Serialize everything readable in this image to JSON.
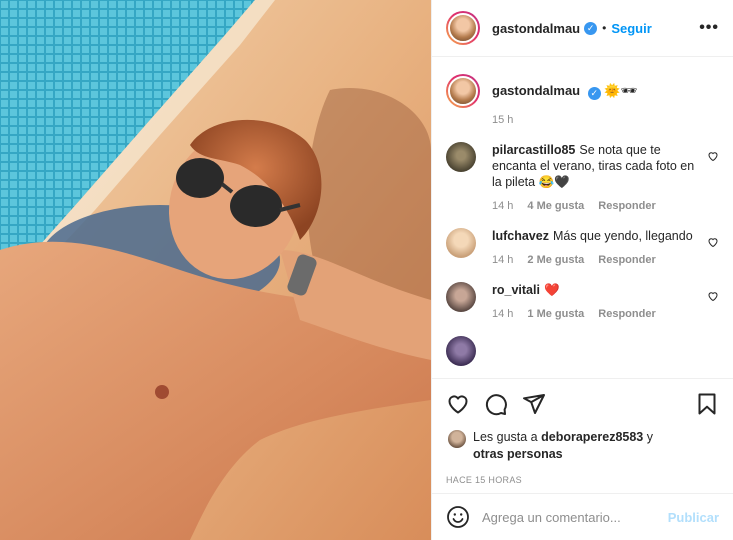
{
  "post": {
    "author": "gastondalmau",
    "follow_label": "Seguir",
    "dot": "•",
    "more_label": "•••",
    "caption_emoji": "🌞🕶",
    "caption_time": "15 h"
  },
  "comments": [
    {
      "username": "pilarcastillo85",
      "text": "Se nota que te encanta el verano, tiras cada foto en la pileta 😂🖤",
      "time": "14 h",
      "likes": "4 Me gusta",
      "reply": "Responder"
    },
    {
      "username": "lufchavez",
      "text": "Más que yendo, llegando",
      "time": "14 h",
      "likes": "2 Me gusta",
      "reply": "Responder"
    },
    {
      "username": "ro_vitali",
      "text": "❤️",
      "time": "14 h",
      "likes": "1 Me gusta",
      "reply": "Responder"
    }
  ],
  "likes": {
    "prefix": "Les gusta a",
    "user": "deboraperez8583",
    "suffix": "y",
    "others": "otras personas"
  },
  "time_ago": "HACE 15 HORAS",
  "comment_box": {
    "placeholder": "Agrega un comentario...",
    "publish_label": "Publicar"
  },
  "icons": {
    "like": "heart-icon",
    "comment": "comment-bubble-icon",
    "share": "paper-plane-icon",
    "save": "bookmark-icon",
    "emoji": "smiley-icon"
  },
  "colors": {
    "link_blue": "#0095f6",
    "publish_disabled": "#b2dffc",
    "muted": "#8e8e8e",
    "verified": "#3897f0"
  }
}
